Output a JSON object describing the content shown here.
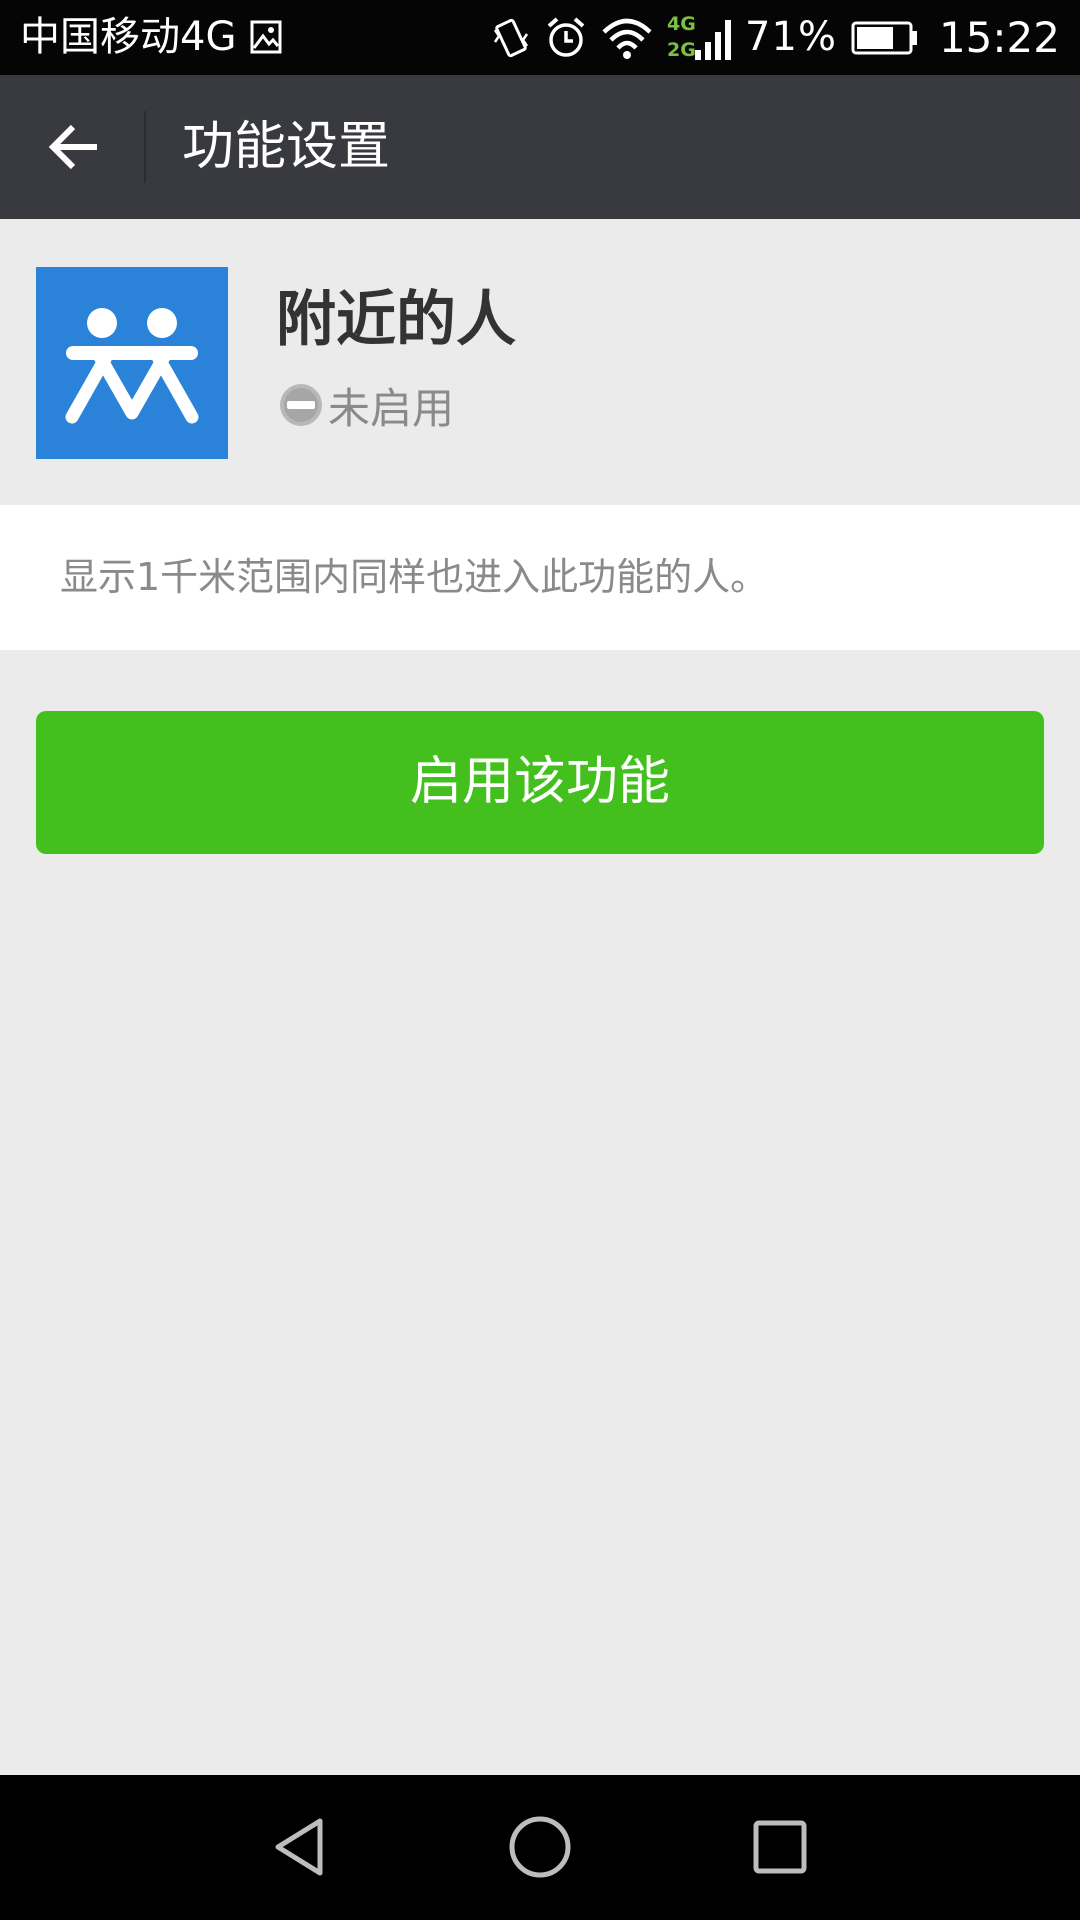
{
  "status_bar": {
    "carrier": "中国移动4G",
    "network_top": "4G",
    "network_bottom": "2G",
    "battery_percent": "71%",
    "battery_level": 0.71,
    "time": "15:22",
    "icons": [
      "image-notification-icon",
      "vibrate-icon",
      "alarm-icon",
      "wifi-icon",
      "cell-signal-icon",
      "battery-icon"
    ]
  },
  "action_bar": {
    "title": "功能设置",
    "back_icon": "arrow-left-icon"
  },
  "feature": {
    "name": "附近的人",
    "status": "未启用",
    "status_icon": "minus-circle-icon",
    "icon": "people-nearby-icon",
    "icon_color": "#2b83d9",
    "description": "显示1千米范围内同样也进入此功能的人。"
  },
  "actions": {
    "enable_label": "启用该功能",
    "enable_color": "#44c01e"
  },
  "nav_bar": {
    "icons": [
      "back-triangle-icon",
      "home-circle-icon",
      "recents-square-icon"
    ]
  },
  "colors": {
    "action_bar_bg": "#393a3f",
    "page_bg": "#ebebeb",
    "status_bar_bg": "#050505"
  }
}
